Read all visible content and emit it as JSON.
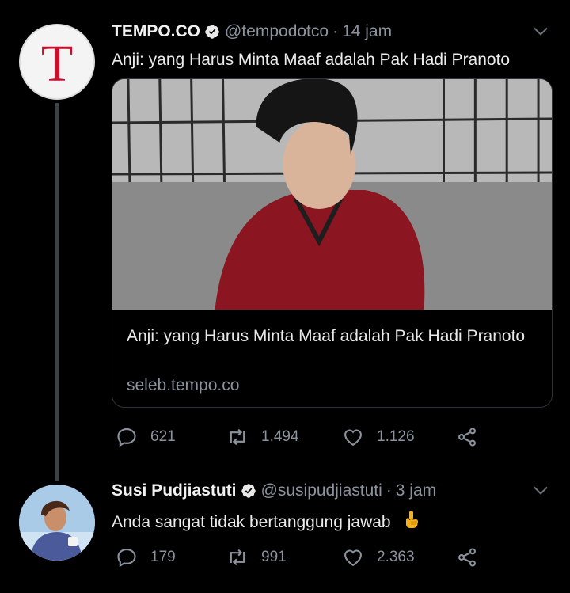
{
  "tweets": [
    {
      "avatar_text": "T",
      "name": "TEMPO.CO",
      "handle": "@tempodotco",
      "separator": "·",
      "time": "14 jam",
      "text": "Anji: yang Harus Minta Maaf adalah Pak Hadi Pranoto",
      "card": {
        "title": "Anji: yang Harus Minta Maaf adalah Pak Hadi Pranoto",
        "domain": "seleb.tempo.co"
      },
      "actions": {
        "replies": "621",
        "retweets": "1.494",
        "likes": "1.126"
      }
    },
    {
      "name": "Susi Pudjiastuti",
      "handle": "@susipudjiastuti",
      "separator": "·",
      "time": "3 jam",
      "text": "Anda sangat tidak bertanggung jawab",
      "emoji": "pointing-up-hand",
      "actions": {
        "replies": "179",
        "retweets": "991",
        "likes": "2.363"
      }
    }
  ],
  "colors": {
    "background": "#000000",
    "secondary_text": "#8b949e",
    "tempo_red": "#c8102e",
    "thread_line": "#3b4148"
  },
  "icons": [
    "verified-badge-icon",
    "chevron-down-icon",
    "reply-icon",
    "retweet-icon",
    "like-icon",
    "share-icon"
  ]
}
